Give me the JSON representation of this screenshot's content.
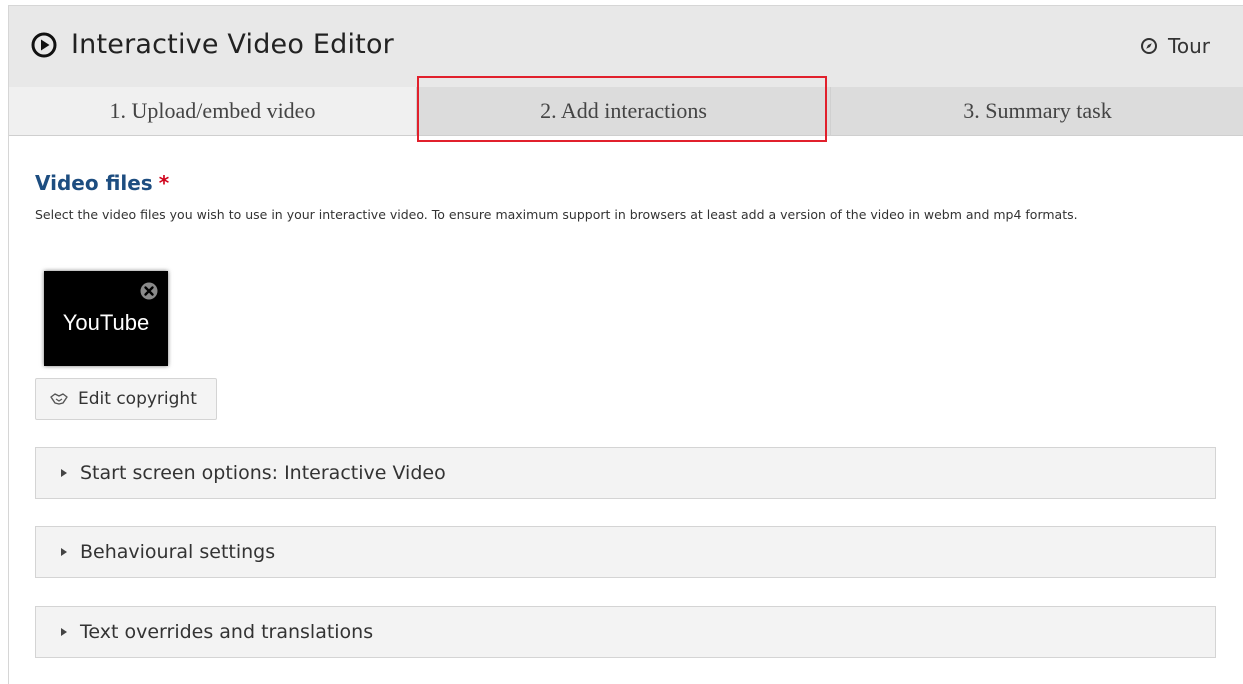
{
  "header": {
    "title": "Interactive Video Editor",
    "tour_label": "Tour"
  },
  "tabs": [
    {
      "label": "1. Upload/embed video",
      "active": true
    },
    {
      "label": "2. Add interactions",
      "active": false,
      "highlighted": true
    },
    {
      "label": "3. Summary task",
      "active": false
    }
  ],
  "video_files": {
    "title": "Video files",
    "required_marker": "*",
    "description": "Select the video files you wish to use in your interactive video. To ensure maximum support in browsers at least add a version of the video in webm and mp4 formats.",
    "video_thumb_label": "YouTube",
    "edit_copyright_label": "Edit copyright"
  },
  "sections": [
    {
      "label": "Start screen options: Interactive Video"
    },
    {
      "label": "Behavioural settings"
    },
    {
      "label": "Text overrides and translations"
    }
  ],
  "colors": {
    "highlight": "#e1202c",
    "section_title": "#1d4d80",
    "required": "#d0021b"
  }
}
